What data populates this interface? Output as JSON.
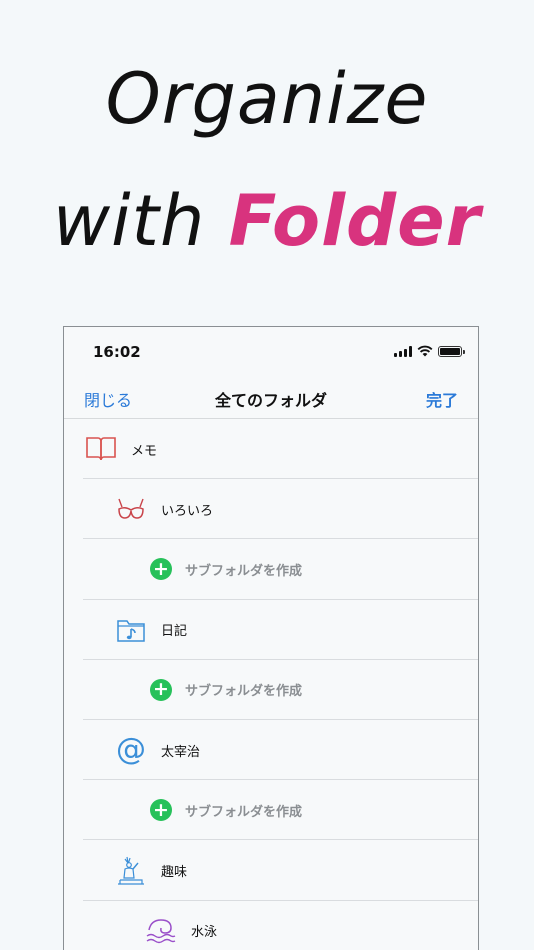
{
  "headline": {
    "line1": "Organize",
    "line2_prefix": "with ",
    "line2_accent": "Folder"
  },
  "status_bar": {
    "time": "16:02"
  },
  "navbar": {
    "left": "閉じる",
    "title": "全てのフォルダ",
    "right": "完了"
  },
  "rows": [
    {
      "label": "メモ",
      "icon": "book-icon"
    },
    {
      "label": "いろいろ",
      "icon": "bra-icon"
    },
    {
      "label": "サブフォルダを作成",
      "icon": "plus-circle-icon"
    },
    {
      "label": "日記",
      "icon": "music-folder-icon"
    },
    {
      "label": "サブフォルダを作成",
      "icon": "plus-circle-icon"
    },
    {
      "label": "太宰治",
      "icon": "at-sign-icon"
    },
    {
      "label": "サブフォルダを作成",
      "icon": "plus-circle-icon"
    },
    {
      "label": "趣味",
      "icon": "statue-of-liberty-icon"
    },
    {
      "label": "水泳",
      "icon": "wave-icon"
    }
  ],
  "colors": {
    "accent": "#d8337e",
    "link": "#2b7ad8",
    "add": "#27c15a"
  }
}
